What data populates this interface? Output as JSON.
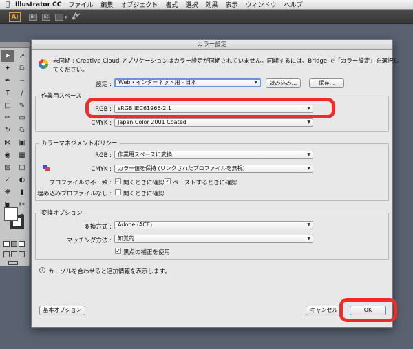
{
  "menubar": {
    "app_name": "Illustrator CC",
    "items": [
      "ファイル",
      "編集",
      "オブジェクト",
      "書式",
      "選択",
      "効果",
      "表示",
      "ウィンドウ",
      "ヘルプ"
    ]
  },
  "appbar": {
    "logo": "Ai",
    "btn1": "Br",
    "btn2": "St"
  },
  "dialog": {
    "title": "カラー設定",
    "warning_line1": "未同期 : Creative Cloud アプリケーションはカラー設定が同期されていません。同期するには、Bridge で「カラー設定」を選択し",
    "warning_line2": "てください。",
    "settings_label": "設定 :",
    "settings_value": "Web・インターネット用 - 日本",
    "load_button": "読み込み...",
    "save_button": "保存...",
    "workspace": {
      "title": "作業用スペース",
      "rgb_label": "RGB :",
      "rgb_value": "sRGB IEC61966-2.1",
      "cmyk_label": "CMYK :",
      "cmyk_value": "Japan Color 2001 Coated"
    },
    "policy": {
      "title": "カラーマネジメントポリシー",
      "rgb_label": "RGB :",
      "rgb_value": "作業用スペースに変換",
      "cmyk_label": "CMYK :",
      "cmyk_value": "カラー値を保持 (リンクされたプロファイルを無視)",
      "mismatch_label": "プロファイルの不一致 :",
      "mismatch_open_label": "開くときに確認",
      "mismatch_paste_label": "ペーストするときに確認",
      "missing_label": "埋め込みプロファイルなし :",
      "missing_open_label": "開くときに確認"
    },
    "conversion": {
      "title": "変換オプション",
      "engine_label": "変換方式 :",
      "engine_value": "Adobe (ACE)",
      "intent_label": "マッチング方法 :",
      "intent_value": "知覚的",
      "bpc_label": "黒点の補正を使用"
    },
    "description": "カーソルを合わせると追加情報を表示します。",
    "advanced_button": "基本オプション",
    "cancel_button": "キャンセル",
    "ok_button": "OK"
  },
  "checkbox_states": {
    "mismatch_open": true,
    "mismatch_paste": true,
    "missing_open": false,
    "bpc": true
  },
  "colors": {
    "highlight_red": "#ef2b2b",
    "focus_blue": "#6b93d6",
    "dialog_bg": "#e8e8e8",
    "desktop_bg": "#5a6272"
  }
}
